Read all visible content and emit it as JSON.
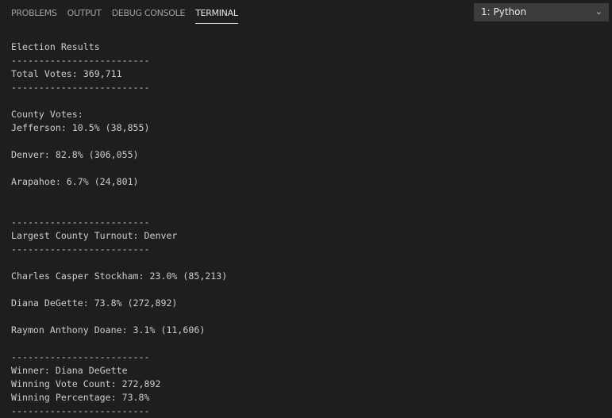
{
  "tabs": [
    {
      "label": "PROBLEMS"
    },
    {
      "label": "OUTPUT"
    },
    {
      "label": "DEBUG CONSOLE"
    },
    {
      "label": "TERMINAL",
      "active": true
    }
  ],
  "terminal_select": {
    "value": "1: Python"
  },
  "terminal_lines": [
    "Election Results",
    "-------------------------",
    "Total Votes: 369,711",
    "-------------------------",
    "",
    "County Votes:",
    "Jefferson: 10.5% (38,855)",
    "",
    "Denver: 82.8% (306,055)",
    "",
    "Arapahoe: 6.7% (24,801)",
    "",
    "",
    "-------------------------",
    "Largest County Turnout: Denver",
    "-------------------------",
    "",
    "Charles Casper Stockham: 23.0% (85,213)",
    "",
    "Diana DeGette: 73.8% (272,892)",
    "",
    "Raymon Anthony Doane: 3.1% (11,606)",
    "",
    "-------------------------",
    "Winner: Diana DeGette",
    "Winning Vote Count: 272,892",
    "Winning Percentage: 73.8%",
    "-------------------------"
  ]
}
